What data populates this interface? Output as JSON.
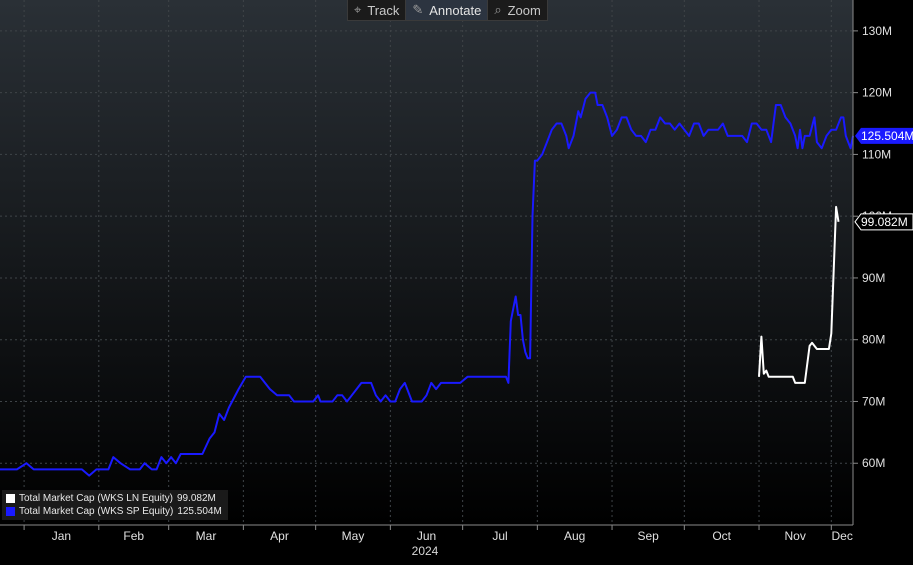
{
  "toolbar": {
    "track_label": "Track",
    "annotate_label": "Annotate",
    "zoom_label": "Zoom"
  },
  "legend": {
    "items": [
      {
        "label": "Total Market Cap (WKS LN Equity)",
        "value": "99.082M",
        "color": "#ffffff"
      },
      {
        "label": "Total Market Cap (WKS SP Equity)",
        "value": "125.504M",
        "color": "#1a1aff"
      }
    ]
  },
  "chart_data": {
    "type": "line",
    "xlabel": "2024",
    "ylabel": "",
    "x_ticks": [
      "Jan",
      "Feb",
      "Mar",
      "Apr",
      "May",
      "Jun",
      "Jul",
      "Aug",
      "Sep",
      "Oct",
      "Nov",
      "Dec"
    ],
    "y_ticks": [
      "60M",
      "70M",
      "80M",
      "90M",
      "100M",
      "110M",
      "120M",
      "130M"
    ],
    "y_tick_values": [
      60,
      70,
      80,
      90,
      100,
      110,
      120,
      130
    ],
    "ylim": [
      50,
      135
    ],
    "xlim": [
      "2023-12-22",
      "2024-12-10"
    ],
    "grid": true,
    "legend_position": "bottom-left",
    "series": [
      {
        "name": "Total Market Cap (WKS LN Equity)",
        "color": "#ffffff",
        "last_label": "99.082M",
        "points": [
          [
            "2024-11-01",
            74
          ],
          [
            "2024-11-02",
            80.5
          ],
          [
            "2024-11-03",
            74.5
          ],
          [
            "2024-11-04",
            75
          ],
          [
            "2024-11-05",
            74
          ],
          [
            "2024-11-08",
            74
          ],
          [
            "2024-11-12",
            74
          ],
          [
            "2024-11-15",
            74
          ],
          [
            "2024-11-16",
            73
          ],
          [
            "2024-11-20",
            73
          ],
          [
            "2024-11-22",
            79
          ],
          [
            "2024-11-23",
            79.5
          ],
          [
            "2024-11-25",
            78.5
          ],
          [
            "2024-11-28",
            78.5
          ],
          [
            "2024-11-30",
            78.5
          ],
          [
            "2024-12-01",
            81
          ],
          [
            "2024-12-03",
            101.5
          ],
          [
            "2024-12-04",
            99.082
          ]
        ]
      },
      {
        "name": "Total Market Cap (WKS SP Equity)",
        "color": "#1a1aff",
        "last_label": "125.504M",
        "points": [
          [
            "2023-12-22",
            59
          ],
          [
            "2023-12-29",
            59
          ],
          [
            "2024-01-02",
            60
          ],
          [
            "2024-01-05",
            59
          ],
          [
            "2024-01-15",
            59
          ],
          [
            "2024-01-25",
            59
          ],
          [
            "2024-01-28",
            58
          ],
          [
            "2024-01-31",
            59
          ],
          [
            "2024-02-05",
            59
          ],
          [
            "2024-02-07",
            61
          ],
          [
            "2024-02-10",
            60
          ],
          [
            "2024-02-14",
            59
          ],
          [
            "2024-02-18",
            59
          ],
          [
            "2024-02-20",
            60
          ],
          [
            "2024-02-23",
            59
          ],
          [
            "2024-02-25",
            59
          ],
          [
            "2024-02-27",
            61
          ],
          [
            "2024-02-29",
            60
          ],
          [
            "2024-03-02",
            61
          ],
          [
            "2024-03-04",
            60
          ],
          [
            "2024-03-06",
            61.5
          ],
          [
            "2024-03-08",
            61.5
          ],
          [
            "2024-03-15",
            61.5
          ],
          [
            "2024-03-18",
            64
          ],
          [
            "2024-03-20",
            65
          ],
          [
            "2024-03-22",
            68
          ],
          [
            "2024-03-24",
            67
          ],
          [
            "2024-03-26",
            69
          ],
          [
            "2024-03-30",
            72
          ],
          [
            "2024-04-02",
            74
          ],
          [
            "2024-04-08",
            74
          ],
          [
            "2024-04-12",
            72
          ],
          [
            "2024-04-15",
            71
          ],
          [
            "2024-04-20",
            71
          ],
          [
            "2024-04-22",
            70
          ],
          [
            "2024-04-30",
            70
          ],
          [
            "2024-05-02",
            71
          ],
          [
            "2024-05-03",
            70
          ],
          [
            "2024-05-08",
            70
          ],
          [
            "2024-05-10",
            71
          ],
          [
            "2024-05-12",
            71
          ],
          [
            "2024-05-14",
            70
          ],
          [
            "2024-05-16",
            71
          ],
          [
            "2024-05-18",
            72
          ],
          [
            "2024-05-20",
            73
          ],
          [
            "2024-05-24",
            73
          ],
          [
            "2024-05-26",
            71
          ],
          [
            "2024-05-28",
            70
          ],
          [
            "2024-05-30",
            71
          ],
          [
            "2024-06-01",
            70
          ],
          [
            "2024-06-03",
            70
          ],
          [
            "2024-06-05",
            72
          ],
          [
            "2024-06-07",
            73
          ],
          [
            "2024-06-10",
            70
          ],
          [
            "2024-06-14",
            70
          ],
          [
            "2024-06-16",
            71
          ],
          [
            "2024-06-18",
            73
          ],
          [
            "2024-06-20",
            72
          ],
          [
            "2024-06-22",
            73
          ],
          [
            "2024-06-25",
            73
          ],
          [
            "2024-06-30",
            73
          ],
          [
            "2024-07-03",
            74
          ],
          [
            "2024-07-08",
            74
          ],
          [
            "2024-07-12",
            74
          ],
          [
            "2024-07-16",
            74
          ],
          [
            "2024-07-19",
            74
          ],
          [
            "2024-07-20",
            73
          ],
          [
            "2024-07-21",
            83
          ],
          [
            "2024-07-22",
            85
          ],
          [
            "2024-07-23",
            87
          ],
          [
            "2024-07-24",
            84
          ],
          [
            "2024-07-25",
            84
          ],
          [
            "2024-07-26",
            80
          ],
          [
            "2024-07-27",
            78
          ],
          [
            "2024-07-28",
            77
          ],
          [
            "2024-07-29",
            77
          ],
          [
            "2024-07-30",
            100
          ],
          [
            "2024-07-31",
            109
          ],
          [
            "2024-08-01",
            109
          ],
          [
            "2024-08-03",
            110
          ],
          [
            "2024-08-05",
            112
          ],
          [
            "2024-08-07",
            114
          ],
          [
            "2024-08-09",
            115
          ],
          [
            "2024-08-11",
            115
          ],
          [
            "2024-08-13",
            113
          ],
          [
            "2024-08-14",
            111
          ],
          [
            "2024-08-16",
            113
          ],
          [
            "2024-08-18",
            117
          ],
          [
            "2024-08-19",
            116
          ],
          [
            "2024-08-21",
            119
          ],
          [
            "2024-08-23",
            120
          ],
          [
            "2024-08-25",
            120
          ],
          [
            "2024-08-26",
            118
          ],
          [
            "2024-08-28",
            118
          ],
          [
            "2024-08-30",
            116
          ],
          [
            "2024-09-01",
            113
          ],
          [
            "2024-09-03",
            114
          ],
          [
            "2024-09-05",
            116
          ],
          [
            "2024-09-07",
            116
          ],
          [
            "2024-09-09",
            114
          ],
          [
            "2024-09-11",
            113
          ],
          [
            "2024-09-13",
            113
          ],
          [
            "2024-09-15",
            112
          ],
          [
            "2024-09-17",
            114
          ],
          [
            "2024-09-19",
            114
          ],
          [
            "2024-09-21",
            116
          ],
          [
            "2024-09-23",
            115
          ],
          [
            "2024-09-25",
            115
          ],
          [
            "2024-09-27",
            114
          ],
          [
            "2024-09-29",
            115
          ],
          [
            "2024-10-01",
            114
          ],
          [
            "2024-10-03",
            113
          ],
          [
            "2024-10-05",
            115
          ],
          [
            "2024-10-07",
            115
          ],
          [
            "2024-10-09",
            113
          ],
          [
            "2024-10-11",
            114
          ],
          [
            "2024-10-13",
            114
          ],
          [
            "2024-10-15",
            114
          ],
          [
            "2024-10-17",
            115
          ],
          [
            "2024-10-19",
            113
          ],
          [
            "2024-10-21",
            113
          ],
          [
            "2024-10-23",
            113
          ],
          [
            "2024-10-25",
            113
          ],
          [
            "2024-10-27",
            112
          ],
          [
            "2024-10-29",
            115
          ],
          [
            "2024-10-31",
            115
          ],
          [
            "2024-11-02",
            114
          ],
          [
            "2024-11-04",
            114
          ],
          [
            "2024-11-06",
            112
          ],
          [
            "2024-11-08",
            118
          ],
          [
            "2024-11-10",
            118
          ],
          [
            "2024-11-12",
            116
          ],
          [
            "2024-11-14",
            115
          ],
          [
            "2024-11-16",
            113
          ],
          [
            "2024-11-17",
            111
          ],
          [
            "2024-11-18",
            114
          ],
          [
            "2024-11-19",
            111
          ],
          [
            "2024-11-20",
            113
          ],
          [
            "2024-11-22",
            113
          ],
          [
            "2024-11-24",
            116
          ],
          [
            "2024-11-25",
            112
          ],
          [
            "2024-11-27",
            111
          ],
          [
            "2024-11-29",
            113
          ],
          [
            "2024-12-01",
            114
          ],
          [
            "2024-12-03",
            114
          ],
          [
            "2024-12-05",
            116
          ],
          [
            "2024-12-06",
            116
          ],
          [
            "2024-12-07",
            113
          ],
          [
            "2024-12-08",
            112
          ],
          [
            "2024-12-09",
            111
          ],
          [
            "2024-12-10",
            113
          ]
        ]
      }
    ]
  }
}
